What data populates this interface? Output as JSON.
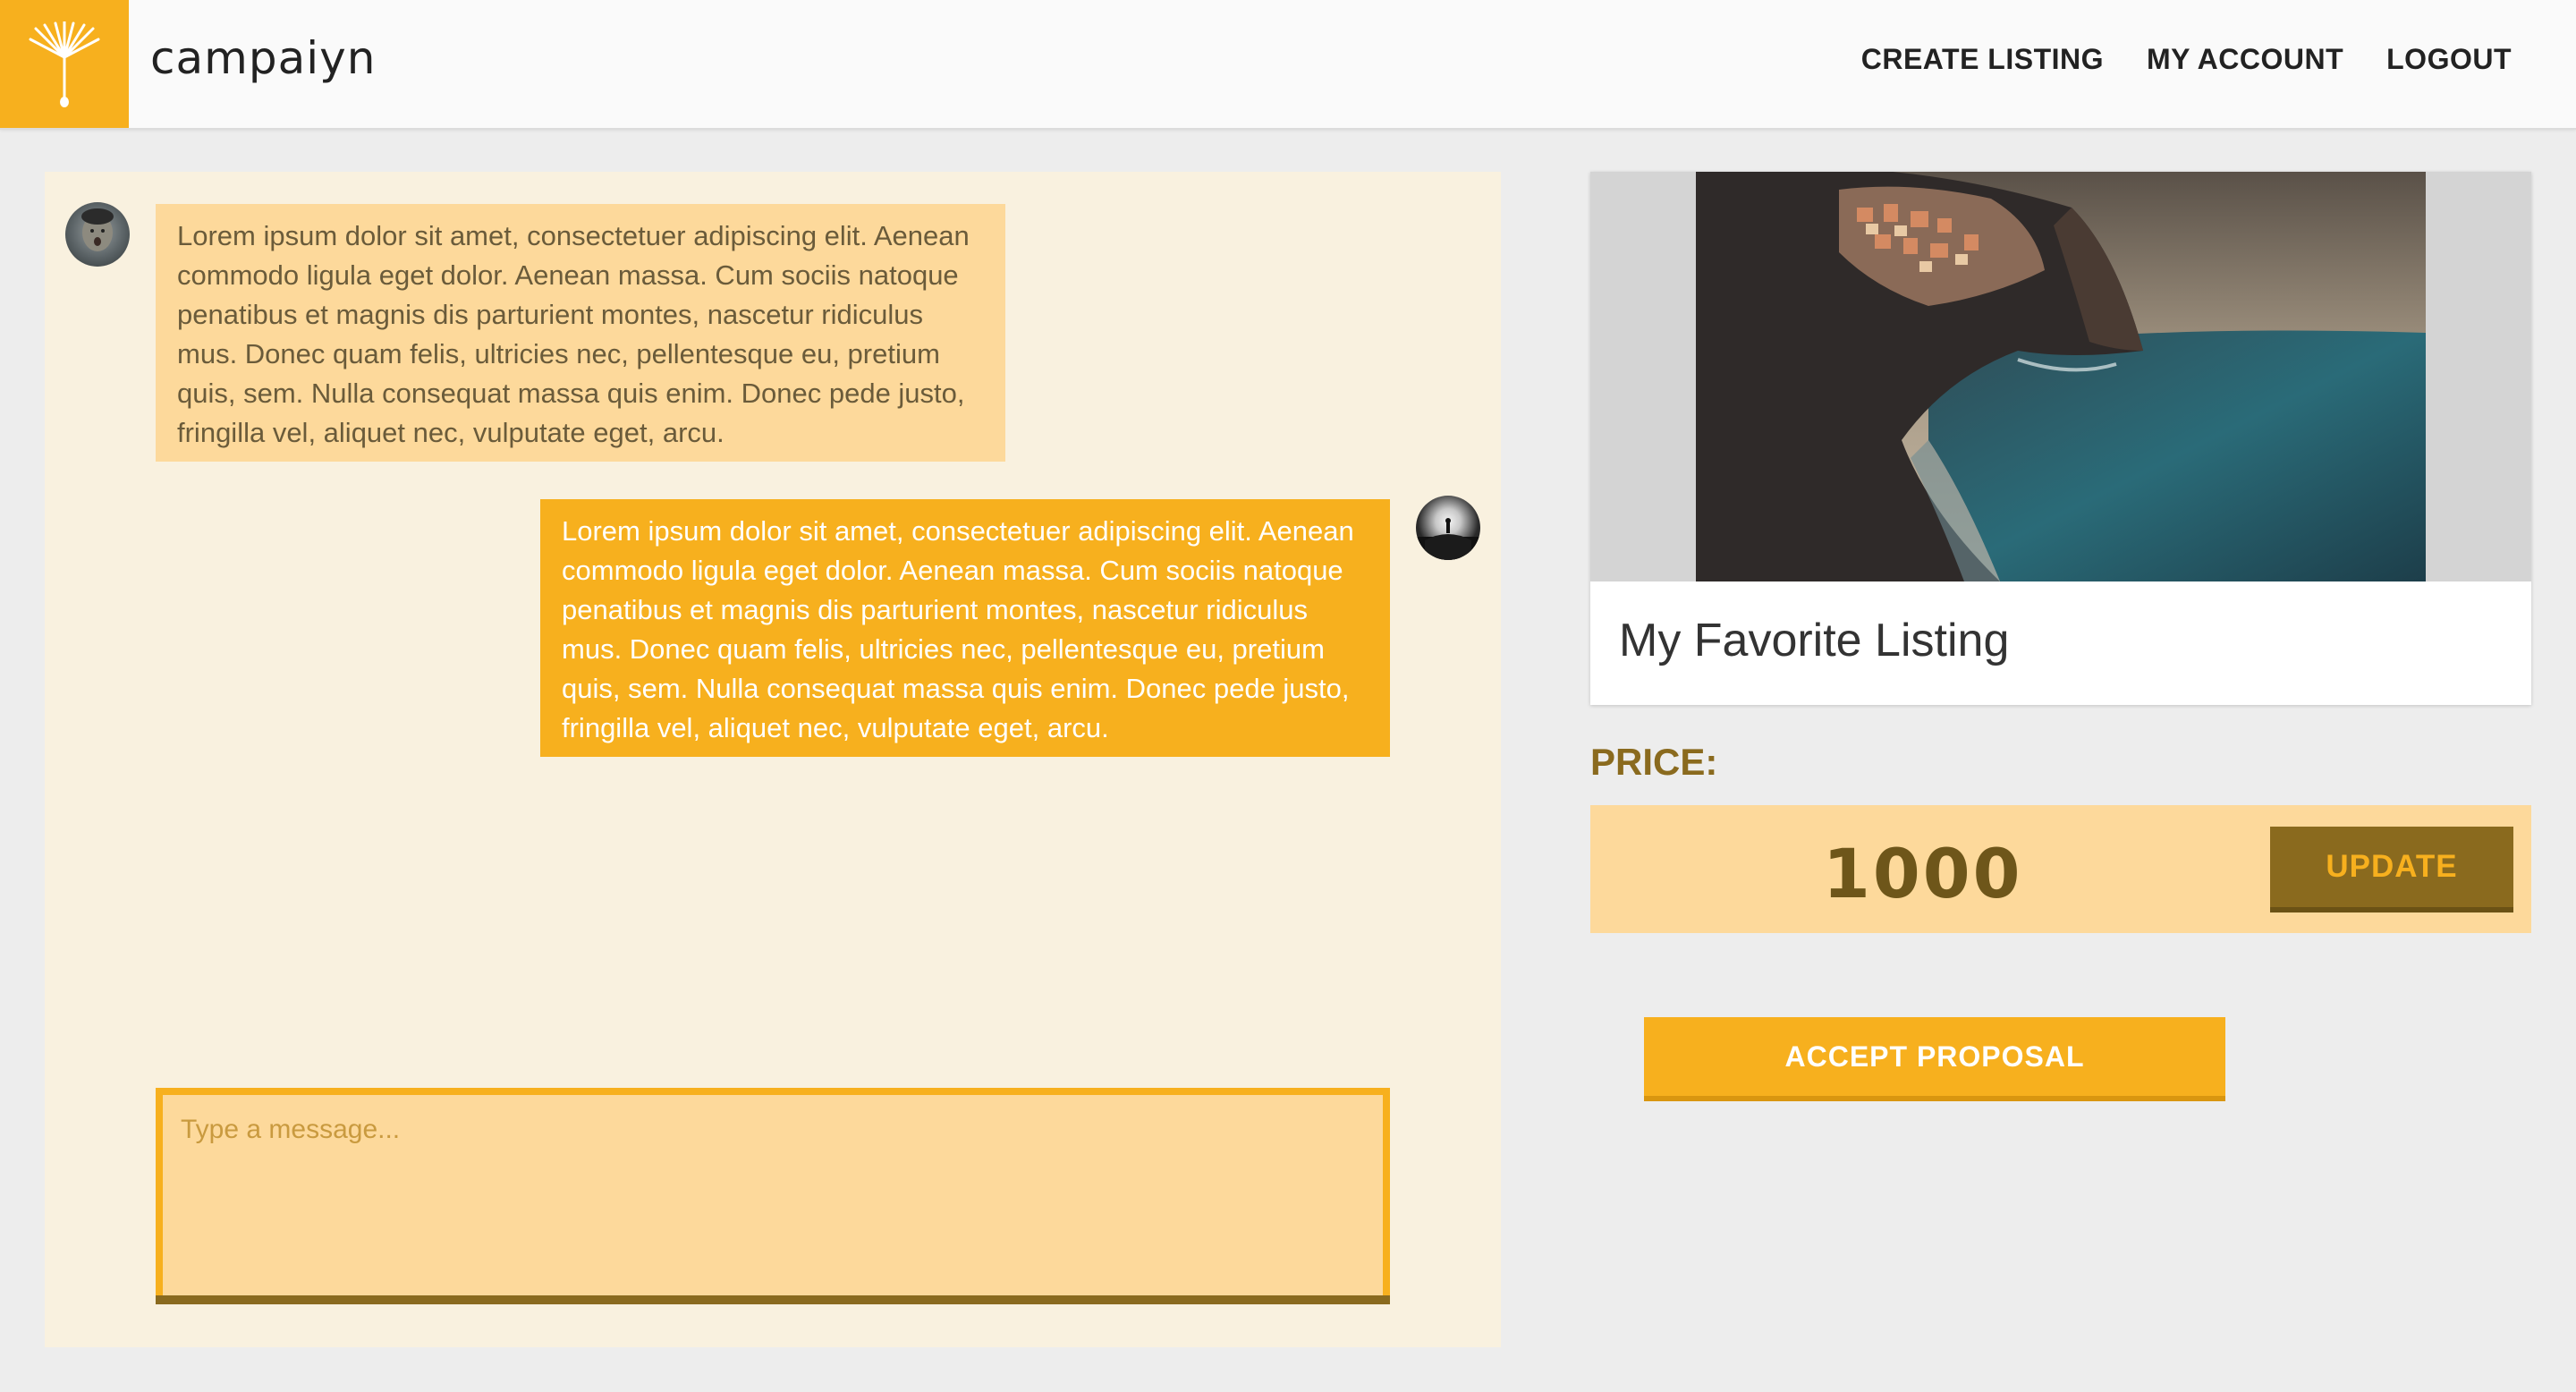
{
  "header": {
    "brand": "campaiyn",
    "nav": {
      "create_listing": "CREATE LISTING",
      "my_account": "MY ACCOUNT",
      "logout": "LOGOUT"
    }
  },
  "chat": {
    "messages": [
      {
        "direction": "incoming",
        "text": "Lorem ipsum dolor sit amet, consectetuer adipiscing elit. Aenean commodo ligula eget dolor. Aenean massa. Cum sociis natoque penatibus et magnis dis parturient montes, nascetur ridiculus mus. Donec quam felis, ultricies nec, pellentesque eu, pretium quis, sem. Nulla consequat massa quis enim. Donec pede justo, fringilla vel, aliquet nec, vulputate eget, arcu."
      },
      {
        "direction": "outgoing",
        "text": "Lorem ipsum dolor sit amet, consectetuer adipiscing elit. Aenean commodo ligula eget dolor. Aenean massa. Cum sociis natoque penatibus et magnis dis parturient montes, nascetur ridiculus mus. Donec quam felis, ultricies nec, pellentesque eu, pretium quis, sem. Nulla consequat massa quis enim. Donec pede justo, fringilla vel, aliquet nec, vulputate eget, arcu."
      }
    ],
    "composer": {
      "placeholder": "Type a message...",
      "value": ""
    }
  },
  "listing": {
    "title": "My Favorite Listing"
  },
  "price": {
    "label": "PRICE:",
    "value": "1000",
    "update_label": "UPDATE"
  },
  "actions": {
    "accept_label": "ACCEPT PROPOSAL"
  },
  "colors": {
    "accent": "#f7b01e",
    "accent_light": "#fdd99b",
    "accent_dark": "#8a6a1e",
    "chat_background": "#f9f1df",
    "page_background": "#ededed"
  },
  "icons": {
    "logo": "dandelion-seed-icon",
    "avatar_incoming": "user-avatar",
    "avatar_outgoing": "user-avatar"
  }
}
